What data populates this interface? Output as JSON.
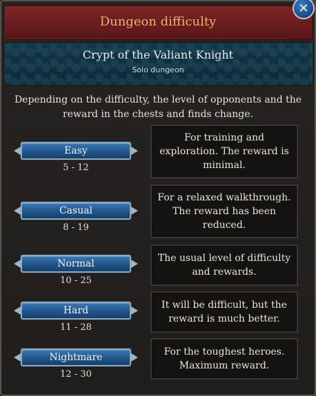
{
  "window": {
    "title": "Dungeon difficulty",
    "close_icon": "close-icon"
  },
  "dungeon": {
    "name": "Crypt of the Valiant Knight",
    "type": "Solo dungeon"
  },
  "description": "Depending on the difficulty, the level of opponents and the reward in the chests and finds change.",
  "difficulties": [
    {
      "label": "Easy",
      "range": "5 - 12",
      "info": "For training and exploration. The reward is minimal."
    },
    {
      "label": "Casual",
      "range": "8 - 19",
      "info": "For a relaxed walkthrough. The reward has been reduced."
    },
    {
      "label": "Normal",
      "range": "10 - 25",
      "info": "The usual level of difficulty and rewards."
    },
    {
      "label": "Hard",
      "range": "11 - 28",
      "info": "It will be difficult, but the reward is much better."
    },
    {
      "label": "Nightmare",
      "range": "12 - 30",
      "info": "For the toughest heroes. Maximum reward."
    }
  ],
  "colors": {
    "title_bar": "#6a1c1f",
    "title_text": "#e8b56b",
    "dungeon_panel": "#143646",
    "button_blue": "#23578c"
  }
}
